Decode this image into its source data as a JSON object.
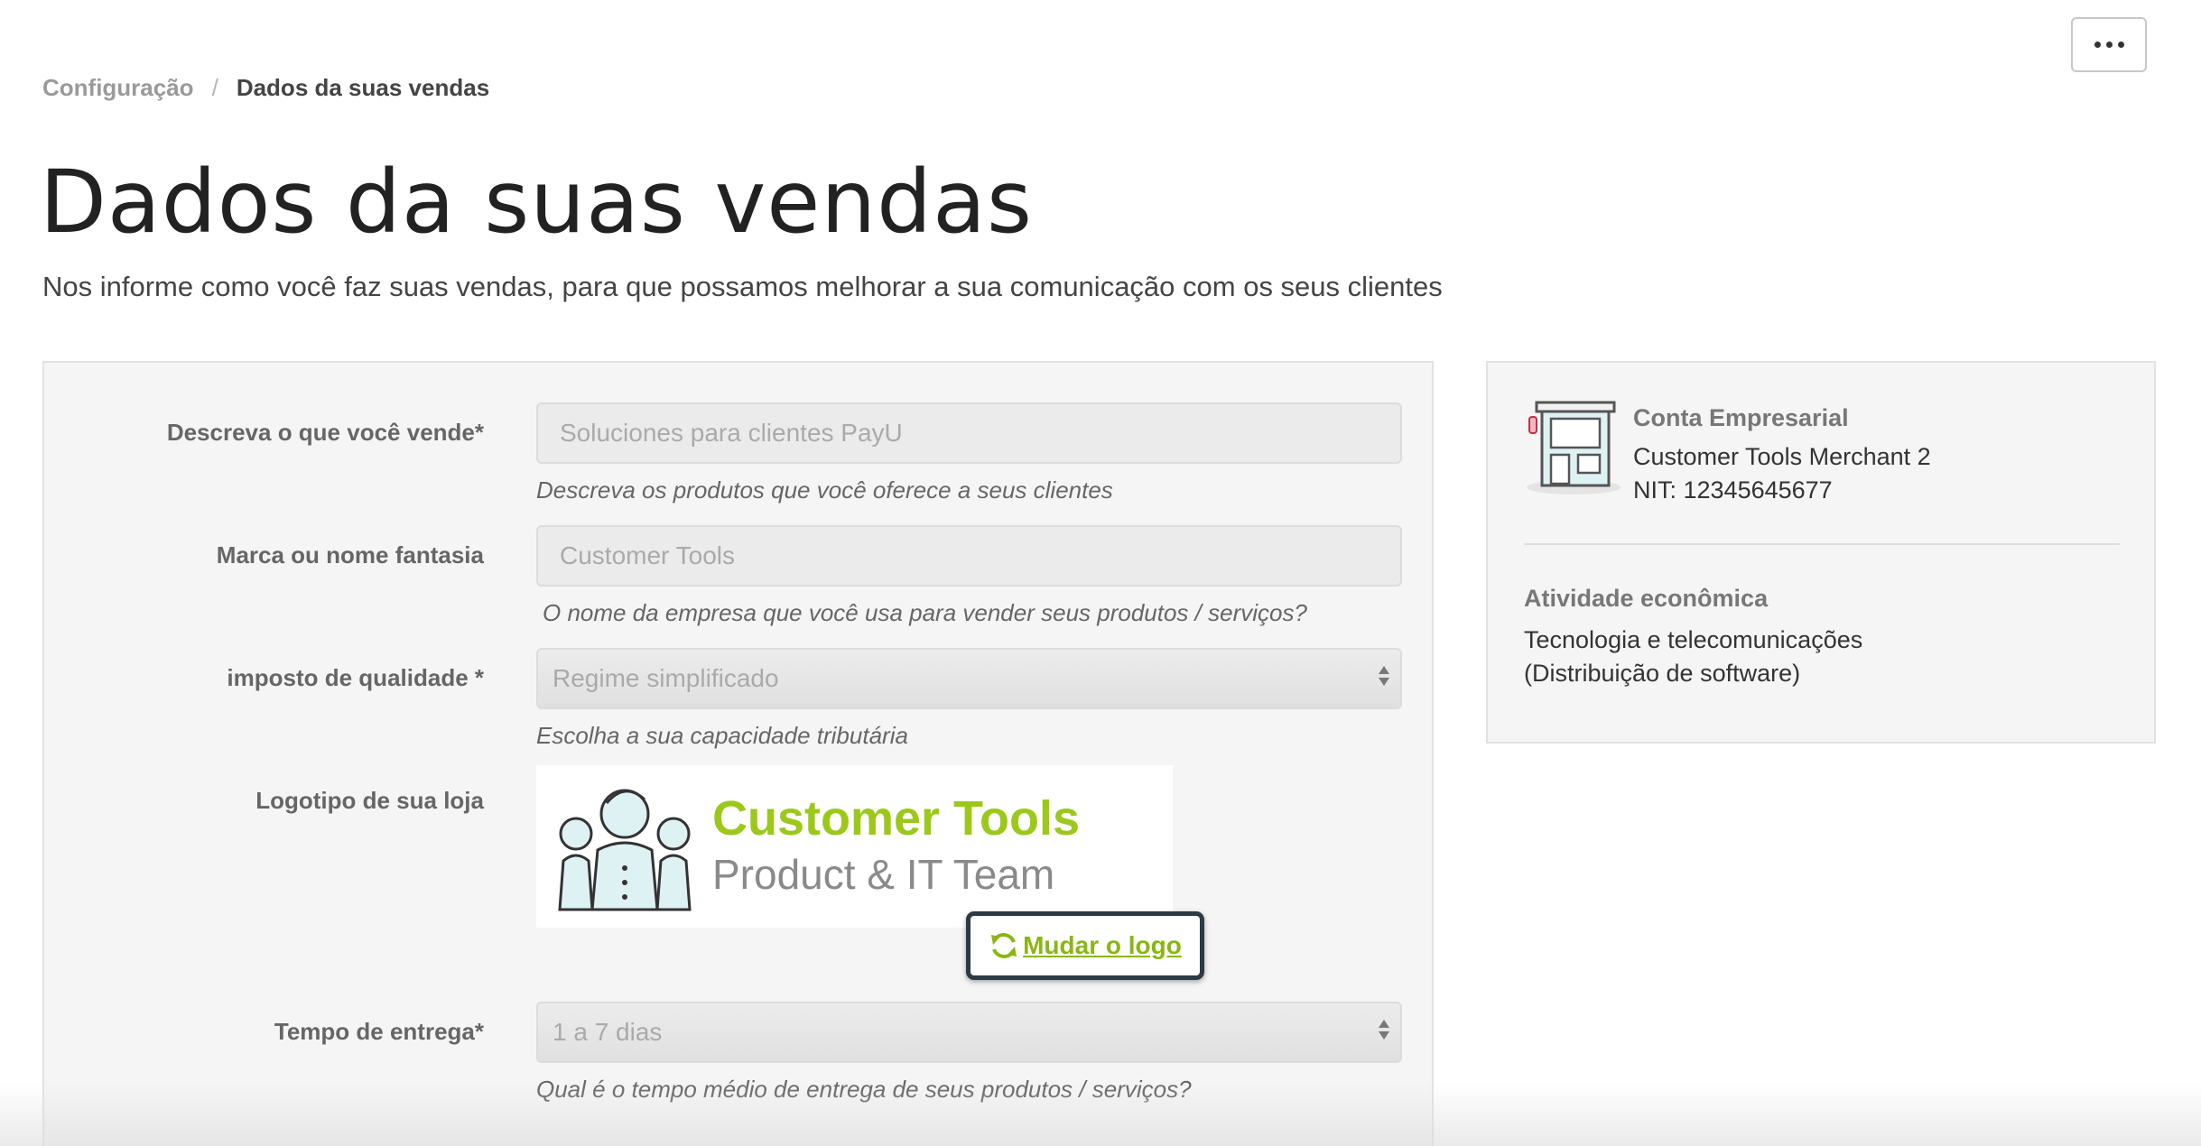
{
  "header": {
    "more_button_icon": "ellipsis-icon"
  },
  "breadcrumb": {
    "parent": "Configuração",
    "separator": "/",
    "current": "Dados da suas vendas"
  },
  "page": {
    "title": "Dados da suas vendas",
    "subtitle": "Nos informe como você faz suas vendas, para que possamos melhorar a sua comunicação com os seus clientes"
  },
  "form": {
    "description": {
      "label": "Descreva o que você vende*",
      "value": "Soluciones para clientes PayU",
      "help": "Descreva os produtos que você oferece a seus clientes"
    },
    "brand": {
      "label": "Marca ou nome fantasia",
      "value": "Customer Tools",
      "help": "O nome da empresa que você usa para vender seus produtos / serviços?"
    },
    "tax": {
      "label": "imposto de qualidade *",
      "value": "Regime simplificado",
      "help": "Escolha a sua capacidade tributária"
    },
    "logo": {
      "label": "Logotipo de sua loja",
      "logo_title": "Customer Tools",
      "logo_subtitle": "Product & IT Team",
      "change_label": "Mudar o logo",
      "change_icon": "refresh-icon"
    },
    "delivery": {
      "label": "Tempo de entrega*",
      "value": "1 a 7 dias",
      "help": "Qual é o tempo médio de entrega de seus produtos / serviços?"
    }
  },
  "account": {
    "icon": "store-icon",
    "title": "Conta Empresarial",
    "name": "Customer Tools Merchant 2",
    "nit": "NIT: 12345645677",
    "activity_title": "Atividade econômica",
    "activity_value": "Tecnologia e telecomunicações (Distribuição de software)"
  },
  "colors": {
    "accent_green": "#9cc81a",
    "focus_border": "#2b3a44"
  }
}
